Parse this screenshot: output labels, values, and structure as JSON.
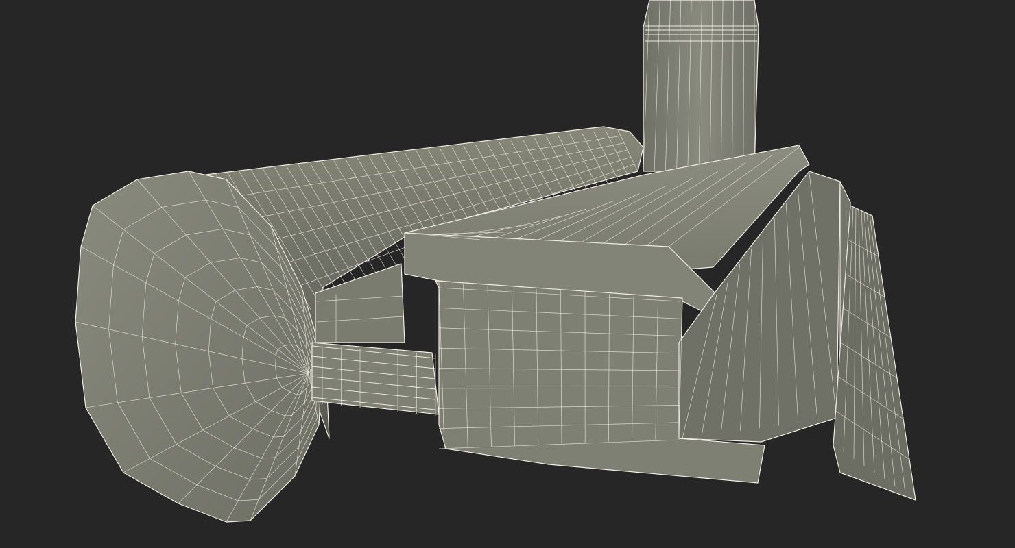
{
  "scene": {
    "background_color": "#262626",
    "mesh_fill_color": "#7d7e72",
    "mesh_fill_dark": "#66675d",
    "mesh_fill_light": "#8e8f83",
    "wireframe_color": "#f3f0e6",
    "objects": [
      "cylinder-tank",
      "chimney",
      "main-block",
      "side-fins",
      "pipe-bundle"
    ]
  }
}
